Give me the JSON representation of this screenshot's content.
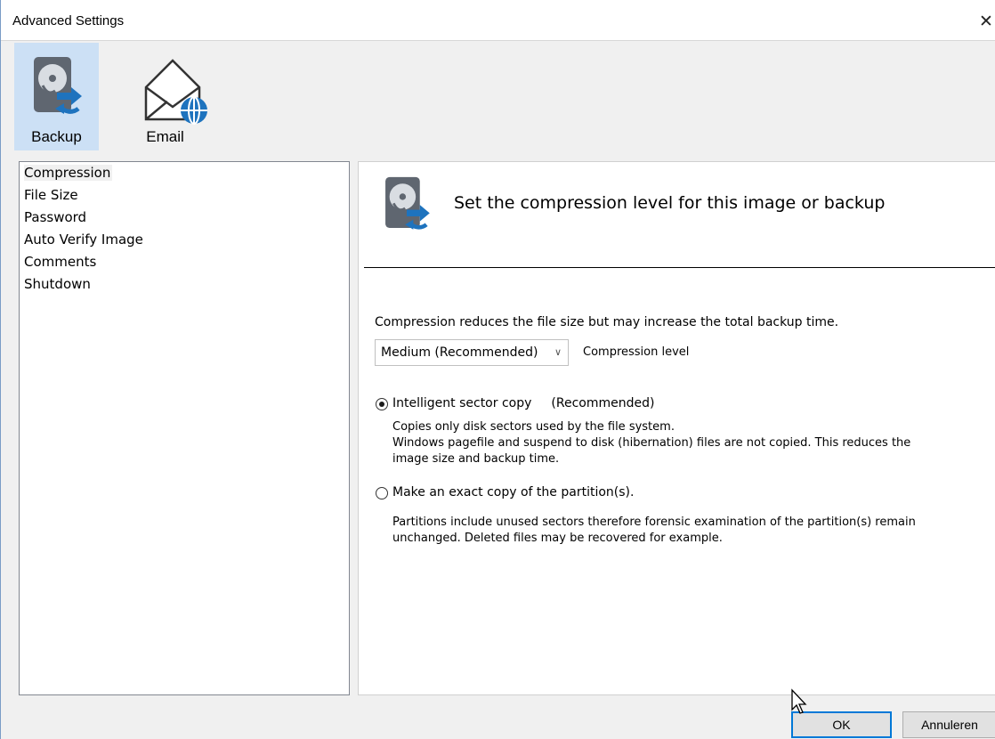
{
  "window": {
    "title": "Advanced Settings",
    "close_glyph": "✕"
  },
  "toolbar": [
    {
      "label": "Backup",
      "icon": "backup-disk-icon",
      "selected": true
    },
    {
      "label": "Email",
      "icon": "email-globe-icon",
      "selected": false
    }
  ],
  "nav": {
    "items": [
      "Compression",
      "File Size",
      "Password",
      "Auto Verify Image",
      "Comments",
      "Shutdown"
    ],
    "selected": "Compression"
  },
  "content": {
    "heading": "Set the compression level for this image or backup",
    "description": "Compression reduces the file size but may increase the total backup time.",
    "compression": {
      "value": "Medium (Recommended)",
      "caption": "Compression level"
    },
    "options": [
      {
        "label": "Intelligent sector copy",
        "tag": "(Recommended)",
        "checked": true,
        "notes": [
          "Copies only disk sectors used by the file system.",
          "Windows pagefile and suspend to disk (hibernation) files are not copied. This reduces the",
          "image size and backup time."
        ]
      },
      {
        "label": "Make an exact copy of the partition(s).",
        "checked": false,
        "notes": [
          "Partitions include unused sectors therefore forensic examination of the partition(s) remain",
          "unchanged. Deleted files may be recovered for example."
        ]
      }
    ]
  },
  "buttons": {
    "ok": "OK",
    "cancel": "Annuleren"
  },
  "colors": {
    "selected_tool": "#cce0f5",
    "accent": "#0078d7",
    "icon_blue": "#1e73be"
  }
}
